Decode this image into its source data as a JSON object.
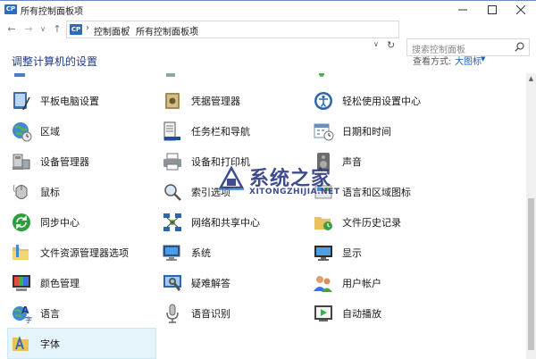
{
  "window": {
    "title": "所有控制面板项",
    "icon_label": "CP"
  },
  "nav": {
    "back": "←",
    "forward": "→",
    "recent": "∨",
    "up": "↑",
    "breadcrumb": [
      "控制面板",
      "所有控制面板项"
    ],
    "separator": "›",
    "dropdown": "∨",
    "refresh": "↻"
  },
  "search": {
    "placeholder": "搜索控制面板"
  },
  "header": {
    "title": "调整计算机的设置",
    "view_by_label": "查看方式:",
    "view_by_value": "大图标",
    "view_by_arrow": "▼"
  },
  "items": [
    {
      "label": "平板电脑设置",
      "icon": "tablet-icon"
    },
    {
      "label": "凭据管理器",
      "icon": "credential-vault-icon"
    },
    {
      "label": "轻松使用设置中心",
      "icon": "ease-of-access-icon"
    },
    {
      "label": "区域",
      "icon": "globe-clock-icon"
    },
    {
      "label": "任务栏和导航",
      "icon": "taskbar-icon"
    },
    {
      "label": "日期和时间",
      "icon": "calendar-clock-icon"
    },
    {
      "label": "设备管理器",
      "icon": "device-manager-icon"
    },
    {
      "label": "设备和打印机",
      "icon": "printer-icon"
    },
    {
      "label": "声音",
      "icon": "speaker-icon"
    },
    {
      "label": "鼠标",
      "icon": "mouse-icon"
    },
    {
      "label": "索引选项",
      "icon": "indexing-icon"
    },
    {
      "label": "语言和区域图标",
      "icon": "region-icon"
    },
    {
      "label": "同步中心",
      "icon": "sync-icon"
    },
    {
      "label": "网络和共享中心",
      "icon": "network-icon"
    },
    {
      "label": "文件历史记录",
      "icon": "file-history-icon"
    },
    {
      "label": "文件资源管理器选项",
      "icon": "folder-options-icon"
    },
    {
      "label": "系统",
      "icon": "system-icon"
    },
    {
      "label": "显示",
      "icon": "display-icon"
    },
    {
      "label": "颜色管理",
      "icon": "color-management-icon"
    },
    {
      "label": "疑难解答",
      "icon": "troubleshooting-icon"
    },
    {
      "label": "用户帐户",
      "icon": "user-accounts-icon"
    },
    {
      "label": "语言",
      "icon": "language-icon"
    },
    {
      "label": "语音识别",
      "icon": "microphone-icon"
    },
    {
      "label": "自动播放",
      "icon": "autoplay-icon"
    },
    {
      "label": "字体",
      "icon": "fonts-icon"
    }
  ],
  "watermark": {
    "main": "系统之家",
    "sub": "XITONGZHIJIA.NET"
  },
  "scrollbar": {
    "up_arrow": "▲"
  }
}
